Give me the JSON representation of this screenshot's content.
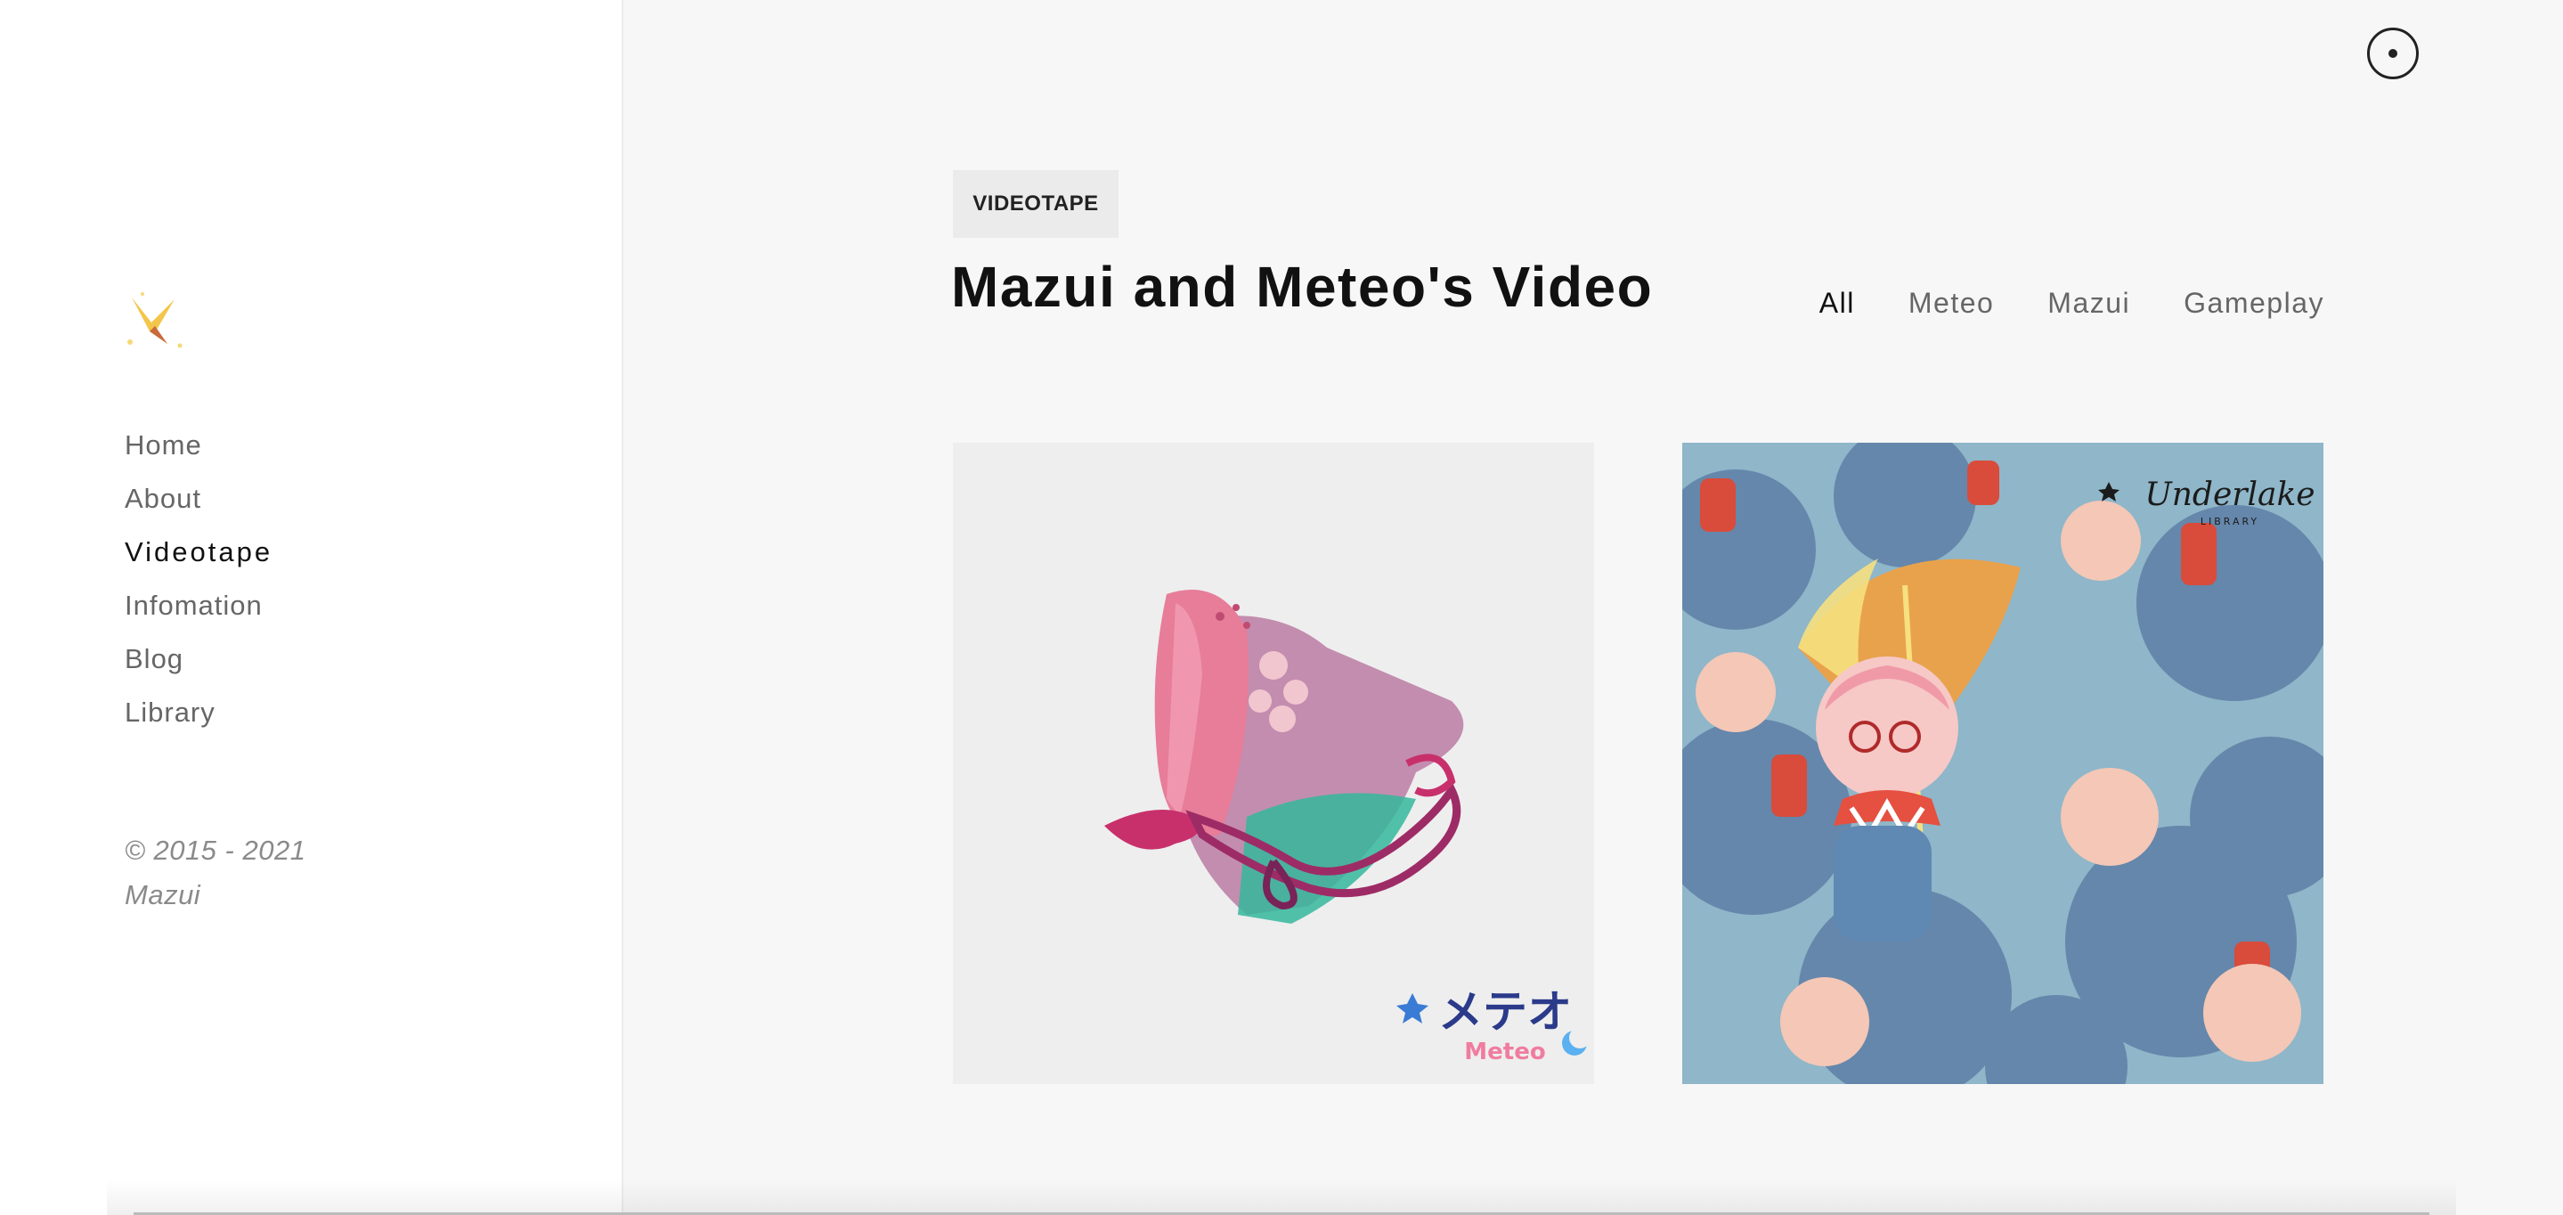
{
  "sidebar": {
    "logo_icon": "sparkle-swallow-logo-icon",
    "nav": [
      {
        "label": "Home"
      },
      {
        "label": "About"
      },
      {
        "label": "Videotape",
        "active": true
      },
      {
        "label": "Infomation"
      },
      {
        "label": "Blog"
      },
      {
        "label": "Library"
      }
    ],
    "copyright_line1": "© 2015 - 2021",
    "copyright_line2": "Mazui"
  },
  "header": {
    "tag": "VIDEOTAPE",
    "title": "Mazui and Meteo's Video",
    "filters": [
      {
        "label": "All",
        "active": true
      },
      {
        "label": "Meteo"
      },
      {
        "label": "Mazui"
      },
      {
        "label": "Gameplay"
      }
    ],
    "theme_toggle_icon": "target-circle-icon"
  },
  "cards": [
    {
      "image": "flower-bouquet-illustration",
      "logo_text_jp": "メテオ",
      "logo_text_en": "Meteo"
    },
    {
      "image": "umbrella-crowd-illustration",
      "logo_text": "Underlake",
      "logo_subtext": "LIBRARY"
    }
  ],
  "colors": {
    "sidebar_bg": "#ffffff",
    "page_bg": "#f7f7f7",
    "accent_yellow": "#f3c64b",
    "text_active": "#111111",
    "text_muted": "#666666"
  }
}
